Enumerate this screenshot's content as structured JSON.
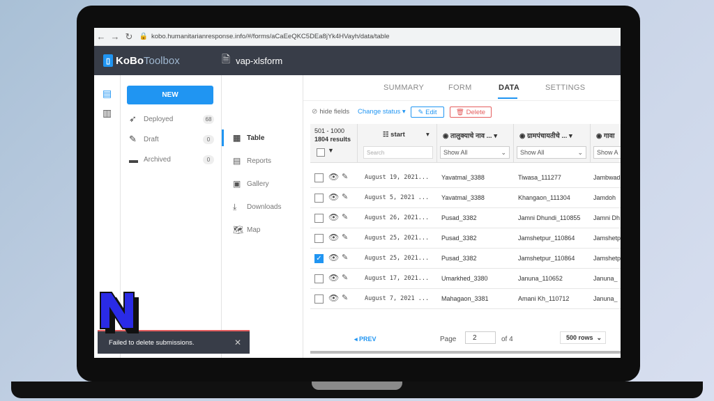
{
  "browser": {
    "url": "kobo.humanitarianresponse.info/#/forms/aCaEeQKC5DEa8jYk4HVayh/data/table"
  },
  "header": {
    "logo_bold": "KoBo",
    "logo_light": "Toolbox",
    "form_name": "vap-xlsform"
  },
  "projects": {
    "new_label": "NEW",
    "items": [
      {
        "label": "Deployed",
        "count": "68"
      },
      {
        "label": "Draft",
        "count": "0"
      },
      {
        "label": "Archived",
        "count": "0"
      }
    ]
  },
  "subnav": {
    "items": [
      {
        "label": "Table"
      },
      {
        "label": "Reports"
      },
      {
        "label": "Gallery"
      },
      {
        "label": "Downloads"
      },
      {
        "label": "Map"
      }
    ]
  },
  "tabs": {
    "summary": "SUMMARY",
    "form": "FORM",
    "data": "DATA",
    "settings": "SETTINGS"
  },
  "toolbar": {
    "hide_fields": "hide fields",
    "change_status": "Change status ▾",
    "edit": "Edit",
    "delete": "Delete"
  },
  "table": {
    "range": "501 - 1000",
    "results": "1804 results",
    "search_placeholder": "Search",
    "columns": [
      {
        "title": "start",
        "filter": ""
      },
      {
        "title": "तालुक्याचे नाव ...",
        "filter": "Show All"
      },
      {
        "title": "ग्रामपंचायतीचे ...",
        "filter": "Show All"
      },
      {
        "title": "गावा",
        "filter": "Show A"
      }
    ],
    "rows": [
      {
        "date": "August 19, 2021...",
        "taluka": "Yavatmal_3388",
        "gp": "Tiwasa_111277",
        "village": "Jambwadi",
        "checked": false
      },
      {
        "date": "August 5, 2021 ...",
        "taluka": "Yavatmal_3388",
        "gp": "Khangaon_111304",
        "village": "Jamdoh",
        "checked": false
      },
      {
        "date": "August 26, 2021...",
        "taluka": "Pusad_3382",
        "gp": "Jamni Dhundi_110855",
        "village": "Jamni Dh",
        "checked": false
      },
      {
        "date": "August 25, 2021...",
        "taluka": "Pusad_3382",
        "gp": "Jamshetpur_110864",
        "village": "Jamshetp",
        "checked": false
      },
      {
        "date": "August 25, 2021...",
        "taluka": "Pusad_3382",
        "gp": "Jamshetpur_110864",
        "village": "Jamshetp",
        "checked": true
      },
      {
        "date": "August 17, 2021...",
        "taluka": "Umarkhed_3380",
        "gp": "Januna_110652",
        "village": "Januna_",
        "checked": false
      },
      {
        "date": "August 7, 2021 ...",
        "taluka": "Mahagaon_3381",
        "gp": "Amani Kh_110712",
        "village": "Januna_",
        "checked": false
      }
    ]
  },
  "pager": {
    "prev": "◂ PREV",
    "page_label": "Page",
    "page_value": "2",
    "of": "of 4",
    "rows": "500 rows"
  },
  "toast": {
    "message": "Failed to delete submissions."
  },
  "colors": {
    "accent": "#2095f2",
    "header_bg": "#383d48",
    "danger": "#e45d5d"
  }
}
